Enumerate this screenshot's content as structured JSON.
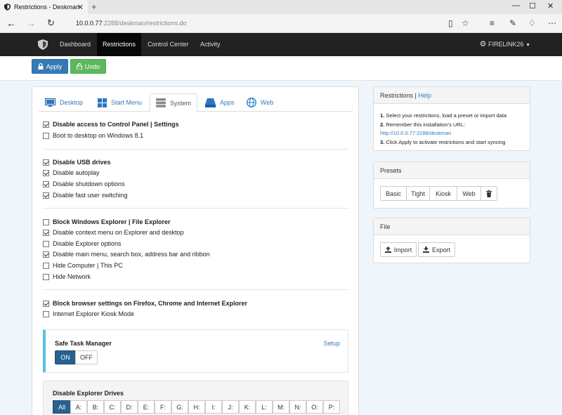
{
  "browser": {
    "tab_title": "Restrictions - Deskman",
    "url_host": "10.0.0.77",
    "url_rest": ":2288/deskman/restrictions.do"
  },
  "navbar": {
    "items": [
      "Dashboard",
      "Restrictions",
      "Control Center",
      "Activity"
    ],
    "active": "Restrictions",
    "user": "FIRELINK26"
  },
  "actions": {
    "apply": "Apply",
    "undo": "Undo"
  },
  "tabs": [
    "Desktop",
    "Start Menu",
    "System",
    "Apps",
    "Web"
  ],
  "options": [
    {
      "label": "Disable access to Control Panel | Settings",
      "checked": true,
      "bold": true
    },
    {
      "label": "Boot to desktop on Windows 8.1",
      "checked": false,
      "bold": false
    },
    {
      "label": "Disable USB drives",
      "checked": true,
      "bold": true
    },
    {
      "label": "Disable autoplay",
      "checked": true,
      "bold": false
    },
    {
      "label": "Disable shutdown options",
      "checked": true,
      "bold": false
    },
    {
      "label": "Disable fast user switching",
      "checked": true,
      "bold": false
    },
    {
      "label": "Block Windows Explorer | File Explorer",
      "checked": false,
      "bold": true
    },
    {
      "label": "Disable context menu on Explorer and desktop",
      "checked": true,
      "bold": false
    },
    {
      "label": "Disable Explorer options",
      "checked": false,
      "bold": false
    },
    {
      "label": "Disable main menu, search box, address bar and ribbon",
      "checked": true,
      "bold": false
    },
    {
      "label": "Hide Computer | This PC",
      "checked": false,
      "bold": false
    },
    {
      "label": "Hide Network",
      "checked": false,
      "bold": false
    },
    {
      "label": "Block browser settings on Firefox, Chrome and Internet Explorer",
      "checked": true,
      "bold": true
    },
    {
      "label": "Internet Explorer Kiosk Mode",
      "checked": false,
      "bold": false
    }
  ],
  "safe_task_manager": {
    "title": "Safe Task Manager",
    "setup": "Setup",
    "on": "ON",
    "off": "OFF"
  },
  "drives": {
    "title": "Disable Explorer Drives",
    "items": [
      "All",
      "A:",
      "B:",
      "C:",
      "D:",
      "E:",
      "F:",
      "G:",
      "H:",
      "I:",
      "J:",
      "K:",
      "L:",
      "M:",
      "N:",
      "O:",
      "P:"
    ]
  },
  "restrictions_panel": {
    "title": "Restrictions",
    "sep": " | ",
    "help": "Help",
    "step1_num": "1.",
    "step1": " Select your restrictions, load a preset or import data",
    "step2_num": "2.",
    "step2": " Remember this installation's URL:",
    "url": "http://10.0.0.77:2288/deskman",
    "step3_num": "3.",
    "step3": " Click Apply to activate restrictions and start syncing"
  },
  "presets": {
    "title": "Presets",
    "items": [
      "Basic",
      "Tight",
      "Kiosk",
      "Web"
    ]
  },
  "file": {
    "title": "File",
    "import": "Import",
    "export": "Export"
  },
  "colors": {
    "primary": "#337ab7",
    "success": "#5cb85c",
    "navbar": "#222222",
    "info_border": "#5bc0de"
  }
}
